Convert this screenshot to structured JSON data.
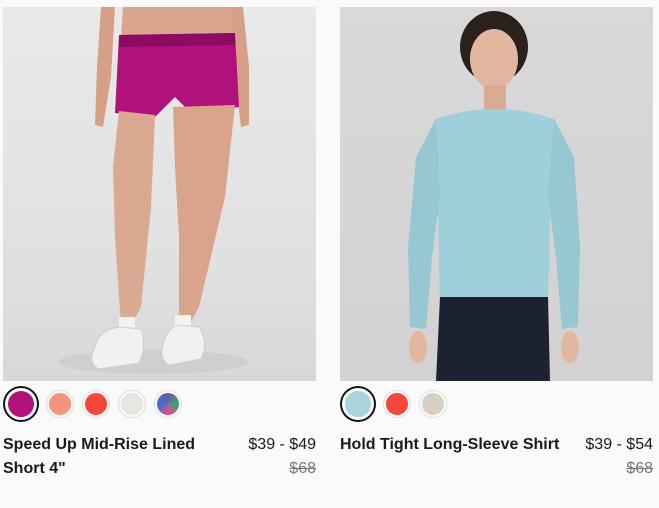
{
  "products": [
    {
      "name": "Speed Up Mid-Rise Lined Short 4\"",
      "price_range": "$39 - $49",
      "original_price": "$68",
      "image_icon": "product-photo-shorts",
      "swatches": [
        {
          "color": "#b0117a",
          "selected": true
        },
        {
          "color": "#f4937b",
          "selected": false
        },
        {
          "color": "#f4473b",
          "selected": false
        },
        {
          "color": "#e8e8e3",
          "selected": false
        },
        {
          "color": "#6a5aa8",
          "selected": false
        }
      ]
    },
    {
      "name": "Hold Tight Long-Sleeve Shirt",
      "price_range": "$39 - $54",
      "original_price": "$68",
      "image_icon": "product-photo-shirt",
      "swatches": [
        {
          "color": "#a9d3df",
          "selected": true
        },
        {
          "color": "#f4473b",
          "selected": false
        },
        {
          "color": "#d9d0c3",
          "selected": false
        }
      ]
    }
  ]
}
